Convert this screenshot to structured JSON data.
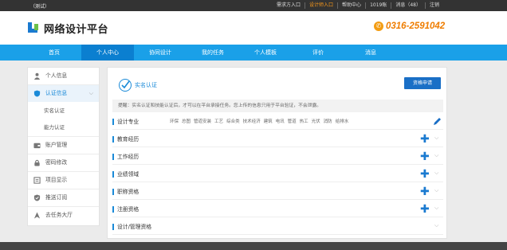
{
  "topbar": {
    "test_label": "（测试）",
    "links": [
      "需求方入口",
      "设计师入口",
      "帮助中心",
      "1019账",
      "消息（48）",
      "注销"
    ]
  },
  "header": {
    "logo_text": "网络设计平台",
    "phone": "0316-2591042",
    "phone_color": "#ef7d00"
  },
  "nav": {
    "items": [
      "首页",
      "个人中心",
      "协同设计",
      "我的任务",
      "个人模板",
      "评价",
      "消息"
    ],
    "active_index": 1,
    "color": "#1aa0e8",
    "active_color": "#0b7fd0"
  },
  "sidebar": {
    "items": [
      {
        "label": "个人信息",
        "icon": "user-icon"
      },
      {
        "label": "认证信息",
        "icon": "shield-icon",
        "active": true
      },
      {
        "label": "实名认证",
        "sub": true
      },
      {
        "label": "能力认证",
        "sub": true
      },
      {
        "label": "账户管理",
        "icon": "wallet-icon"
      },
      {
        "label": "密码修改",
        "icon": "lock-icon"
      },
      {
        "label": "项目显示",
        "icon": "list-icon"
      },
      {
        "label": "推送订阅",
        "icon": "shield-check-icon"
      },
      {
        "label": "去任务大厅",
        "icon": "navigate-icon"
      }
    ]
  },
  "main": {
    "cert_title": "实名认证",
    "apply_button": "资格申请",
    "tip": "提醒：实名认证和技能认证后，才可以在平台承接任务。您上传的信息只用于平台验证，不会泄露。",
    "rows": [
      {
        "label": "设计专业",
        "tags": [
          "环保",
          "总图",
          "管道安装",
          "工艺",
          "综合类",
          "技术经济",
          "建筑",
          "电讯",
          "管道",
          "热工",
          "光伏",
          "消防",
          "给排水"
        ]
      },
      {
        "label": "教育经历"
      },
      {
        "label": "工作经历"
      },
      {
        "label": "业绩领域"
      },
      {
        "label": "职称资格"
      },
      {
        "label": "注册资格"
      },
      {
        "label": "设计/管理资格"
      }
    ]
  }
}
